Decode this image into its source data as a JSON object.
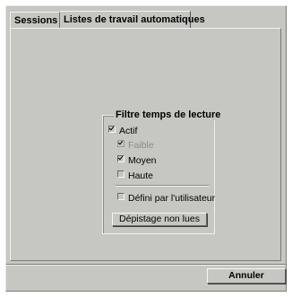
{
  "tabs": [
    {
      "label": "Sessions",
      "active": false
    },
    {
      "label": "Listes de travail automatiques",
      "active": true
    }
  ],
  "filter_group": {
    "title": "Filtre temps de lecture",
    "active": {
      "label": "Actif",
      "checked": true
    },
    "options": [
      {
        "label": "Faible",
        "checked": true,
        "disabled": true
      },
      {
        "label": "Moyen",
        "checked": true,
        "disabled": false
      },
      {
        "label": "Haute",
        "checked": false,
        "disabled": false
      }
    ],
    "custom": {
      "label": "Défini par l'utilisateur",
      "checked": false
    },
    "button_label": "Dépistage non lues"
  },
  "footer": {
    "cancel_label": "Annuler"
  }
}
